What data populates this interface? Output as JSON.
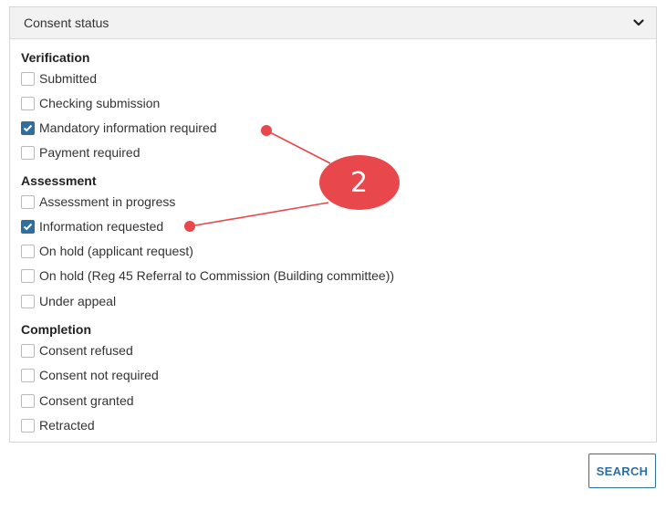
{
  "panel": {
    "title": "Consent status",
    "icon": "chevron-down-icon"
  },
  "groups": [
    {
      "title": "Verification",
      "options": [
        {
          "label": "Submitted",
          "checked": false
        },
        {
          "label": "Checking submission",
          "checked": false
        },
        {
          "label": "Mandatory information required",
          "checked": true
        },
        {
          "label": "Payment required",
          "checked": false
        }
      ]
    },
    {
      "title": "Assessment",
      "options": [
        {
          "label": "Assessment in progress",
          "checked": false
        },
        {
          "label": "Information requested",
          "checked": true
        },
        {
          "label": "On hold (applicant request)",
          "checked": false
        },
        {
          "label": "On hold (Reg 45 Referral to Commission (Building committee))",
          "checked": false
        },
        {
          "label": "Under appeal",
          "checked": false
        }
      ]
    },
    {
      "title": "Completion",
      "options": [
        {
          "label": "Consent refused",
          "checked": false
        },
        {
          "label": "Consent not required",
          "checked": false
        },
        {
          "label": "Consent granted",
          "checked": false
        },
        {
          "label": "Retracted",
          "checked": false
        }
      ]
    }
  ],
  "search_button": {
    "label": "SEARCH"
  },
  "callout": {
    "number": "2",
    "color": "#e8474c"
  },
  "colors": {
    "accent": "#2f6f9f",
    "callout": "#e8474c"
  }
}
